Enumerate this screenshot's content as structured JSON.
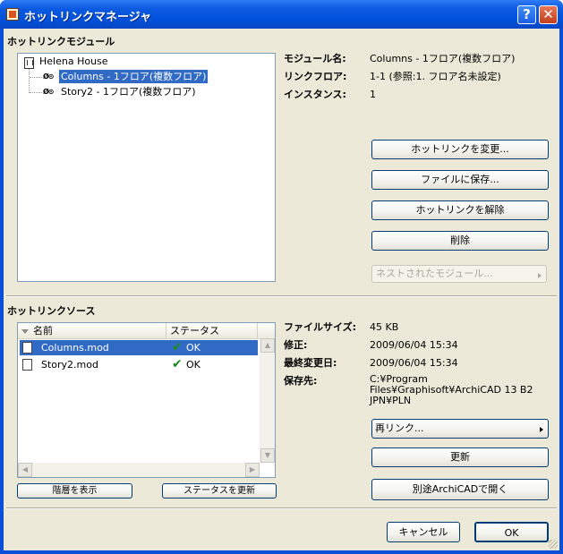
{
  "window": {
    "title": "ホットリンクマネージャ",
    "help": "?",
    "close": "✕"
  },
  "modules": {
    "section": "ホットリンクモジュール",
    "tree": [
      {
        "label": "Helena House"
      },
      {
        "icon": "Ø⊙",
        "label": "Columns - 1フロア(複数フロア)"
      },
      {
        "icon": "Ø⊙",
        "label": "Story2 - 1フロア(複数フロア)"
      }
    ],
    "props": [
      {
        "label": "モジュール名:",
        "value": "Columns - 1フロア(複数フロア)"
      },
      {
        "label": "リンクフロア:",
        "value": "1-1 (参照:1. フロア名未設定)"
      },
      {
        "label": "インスタンス:",
        "value": "1"
      }
    ],
    "buttons": {
      "change": "ホットリンクを変更...",
      "save": "ファイルに保存...",
      "break": "ホットリンクを解除",
      "delete": "削除",
      "nested": "ネストされたモジュール..."
    }
  },
  "sources": {
    "section": "ホットリンクソース",
    "columns": {
      "name": "名前",
      "status": "ステータス"
    },
    "rows": [
      {
        "name": "Columns.mod",
        "status": "OK"
      },
      {
        "name": "Story2.mod",
        "status": "OK"
      }
    ],
    "props": [
      {
        "label": "ファイルサイズ:",
        "value": "45 KB"
      },
      {
        "label": "修正:",
        "value": "2009/06/04 15:34"
      },
      {
        "label": "最終変更日:",
        "value": "2009/06/04 15:34"
      },
      {
        "label": "保存先:",
        "lines": [
          "C:¥Program",
          "Files¥Graphisoft¥ArchiCAD 13 B2",
          "JPN¥PLN"
        ]
      }
    ],
    "buttons": {
      "relink": "再リンク...",
      "update": "更新",
      "open": "別途ArchiCADで開く",
      "show_hierarchy": "階層を表示",
      "update_status": "ステータスを更新"
    }
  },
  "footer": {
    "cancel": "キャンセル",
    "ok": "OK"
  }
}
